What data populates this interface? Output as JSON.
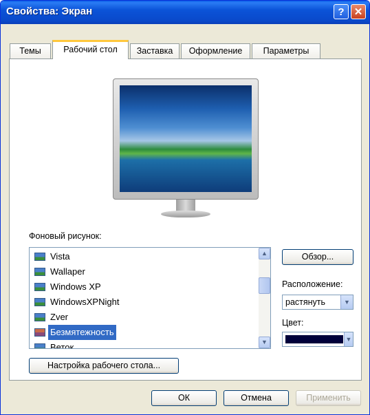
{
  "window": {
    "title": "Свойства: Экран"
  },
  "titlebar_buttons": {
    "help": "?",
    "close": "✕"
  },
  "tabs": [
    {
      "label": "Темы"
    },
    {
      "label": "Рабочий стол"
    },
    {
      "label": "Заставка"
    },
    {
      "label": "Оформление"
    },
    {
      "label": "Параметры"
    }
  ],
  "active_tab": "Рабочий стол",
  "background": {
    "label": "Фоновый рисунок:",
    "items": [
      "Vista",
      "Wallaper",
      "Windows XP",
      "WindowsXPNight",
      "Zver",
      "Безмятежность",
      "Веток"
    ],
    "selected": "Безмятежность"
  },
  "browse_button": "Обзор...",
  "position": {
    "label": "Расположение:",
    "value": "растянуть"
  },
  "color": {
    "label": "Цвет:",
    "value_hex": "#00003a"
  },
  "customize_button": "Настройка рабочего стола...",
  "footer": {
    "ok": "ОК",
    "cancel": "Отмена",
    "apply": "Применить"
  }
}
